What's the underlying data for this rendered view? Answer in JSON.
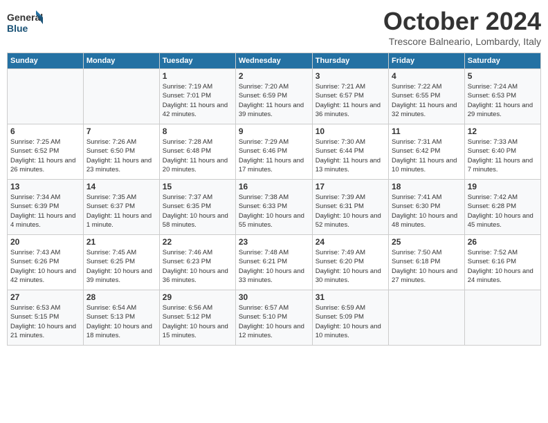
{
  "header": {
    "logo_general": "General",
    "logo_blue": "Blue",
    "month": "October 2024",
    "location": "Trescore Balneario, Lombardy, Italy"
  },
  "weekdays": [
    "Sunday",
    "Monday",
    "Tuesday",
    "Wednesday",
    "Thursday",
    "Friday",
    "Saturday"
  ],
  "weeks": [
    [
      {
        "day": "",
        "info": ""
      },
      {
        "day": "",
        "info": ""
      },
      {
        "day": "1",
        "info": "Sunrise: 7:19 AM\nSunset: 7:01 PM\nDaylight: 11 hours and 42 minutes."
      },
      {
        "day": "2",
        "info": "Sunrise: 7:20 AM\nSunset: 6:59 PM\nDaylight: 11 hours and 39 minutes."
      },
      {
        "day": "3",
        "info": "Sunrise: 7:21 AM\nSunset: 6:57 PM\nDaylight: 11 hours and 36 minutes."
      },
      {
        "day": "4",
        "info": "Sunrise: 7:22 AM\nSunset: 6:55 PM\nDaylight: 11 hours and 32 minutes."
      },
      {
        "day": "5",
        "info": "Sunrise: 7:24 AM\nSunset: 6:53 PM\nDaylight: 11 hours and 29 minutes."
      }
    ],
    [
      {
        "day": "6",
        "info": "Sunrise: 7:25 AM\nSunset: 6:52 PM\nDaylight: 11 hours and 26 minutes."
      },
      {
        "day": "7",
        "info": "Sunrise: 7:26 AM\nSunset: 6:50 PM\nDaylight: 11 hours and 23 minutes."
      },
      {
        "day": "8",
        "info": "Sunrise: 7:28 AM\nSunset: 6:48 PM\nDaylight: 11 hours and 20 minutes."
      },
      {
        "day": "9",
        "info": "Sunrise: 7:29 AM\nSunset: 6:46 PM\nDaylight: 11 hours and 17 minutes."
      },
      {
        "day": "10",
        "info": "Sunrise: 7:30 AM\nSunset: 6:44 PM\nDaylight: 11 hours and 13 minutes."
      },
      {
        "day": "11",
        "info": "Sunrise: 7:31 AM\nSunset: 6:42 PM\nDaylight: 11 hours and 10 minutes."
      },
      {
        "day": "12",
        "info": "Sunrise: 7:33 AM\nSunset: 6:40 PM\nDaylight: 11 hours and 7 minutes."
      }
    ],
    [
      {
        "day": "13",
        "info": "Sunrise: 7:34 AM\nSunset: 6:39 PM\nDaylight: 11 hours and 4 minutes."
      },
      {
        "day": "14",
        "info": "Sunrise: 7:35 AM\nSunset: 6:37 PM\nDaylight: 11 hours and 1 minute."
      },
      {
        "day": "15",
        "info": "Sunrise: 7:37 AM\nSunset: 6:35 PM\nDaylight: 10 hours and 58 minutes."
      },
      {
        "day": "16",
        "info": "Sunrise: 7:38 AM\nSunset: 6:33 PM\nDaylight: 10 hours and 55 minutes."
      },
      {
        "day": "17",
        "info": "Sunrise: 7:39 AM\nSunset: 6:31 PM\nDaylight: 10 hours and 52 minutes."
      },
      {
        "day": "18",
        "info": "Sunrise: 7:41 AM\nSunset: 6:30 PM\nDaylight: 10 hours and 48 minutes."
      },
      {
        "day": "19",
        "info": "Sunrise: 7:42 AM\nSunset: 6:28 PM\nDaylight: 10 hours and 45 minutes."
      }
    ],
    [
      {
        "day": "20",
        "info": "Sunrise: 7:43 AM\nSunset: 6:26 PM\nDaylight: 10 hours and 42 minutes."
      },
      {
        "day": "21",
        "info": "Sunrise: 7:45 AM\nSunset: 6:25 PM\nDaylight: 10 hours and 39 minutes."
      },
      {
        "day": "22",
        "info": "Sunrise: 7:46 AM\nSunset: 6:23 PM\nDaylight: 10 hours and 36 minutes."
      },
      {
        "day": "23",
        "info": "Sunrise: 7:48 AM\nSunset: 6:21 PM\nDaylight: 10 hours and 33 minutes."
      },
      {
        "day": "24",
        "info": "Sunrise: 7:49 AM\nSunset: 6:20 PM\nDaylight: 10 hours and 30 minutes."
      },
      {
        "day": "25",
        "info": "Sunrise: 7:50 AM\nSunset: 6:18 PM\nDaylight: 10 hours and 27 minutes."
      },
      {
        "day": "26",
        "info": "Sunrise: 7:52 AM\nSunset: 6:16 PM\nDaylight: 10 hours and 24 minutes."
      }
    ],
    [
      {
        "day": "27",
        "info": "Sunrise: 6:53 AM\nSunset: 5:15 PM\nDaylight: 10 hours and 21 minutes."
      },
      {
        "day": "28",
        "info": "Sunrise: 6:54 AM\nSunset: 5:13 PM\nDaylight: 10 hours and 18 minutes."
      },
      {
        "day": "29",
        "info": "Sunrise: 6:56 AM\nSunset: 5:12 PM\nDaylight: 10 hours and 15 minutes."
      },
      {
        "day": "30",
        "info": "Sunrise: 6:57 AM\nSunset: 5:10 PM\nDaylight: 10 hours and 12 minutes."
      },
      {
        "day": "31",
        "info": "Sunrise: 6:59 AM\nSunset: 5:09 PM\nDaylight: 10 hours and 10 minutes."
      },
      {
        "day": "",
        "info": ""
      },
      {
        "day": "",
        "info": ""
      }
    ]
  ]
}
